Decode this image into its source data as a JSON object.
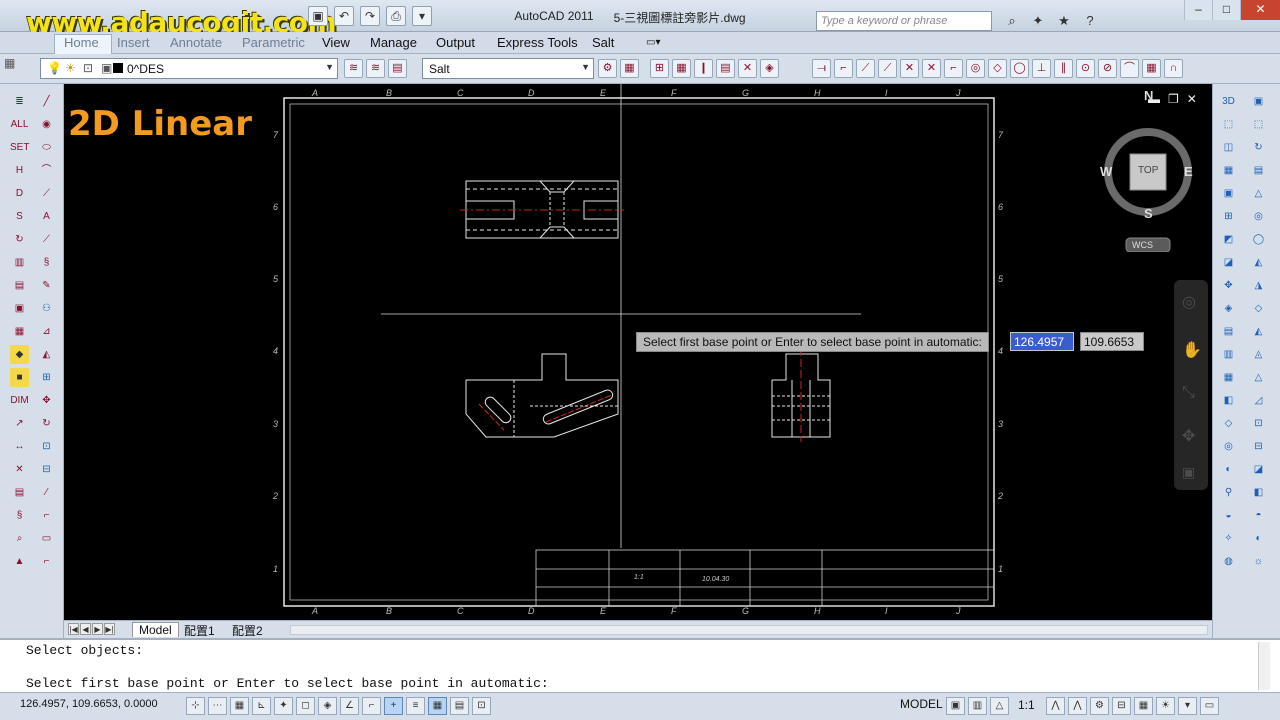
{
  "titlebar": {
    "watermark": "www.adaucogit.com",
    "app_name": "AutoCAD 2011",
    "file_name": "5-三視圖標註旁影片.dwg",
    "search_placeholder": "Type a keyword or phrase"
  },
  "menubar": {
    "items": [
      "Home",
      "Insert",
      "Annotate",
      "Parametric",
      "View",
      "Manage",
      "Output",
      "Express Tools",
      "Salt"
    ]
  },
  "toolbar": {
    "layer_value": "0^DES",
    "style_value": "Salt"
  },
  "canvas": {
    "overlay_title": "2D Linear",
    "border_letters": [
      "A",
      "B",
      "C",
      "D",
      "E",
      "F",
      "G",
      "H",
      "I",
      "J"
    ],
    "border_numbers": [
      "7",
      "6",
      "5",
      "4",
      "3",
      "2",
      "1"
    ],
    "viewcube": {
      "north": "N",
      "south": "S",
      "east": "E",
      "west": "W",
      "face": "TOP",
      "ucs": "WCS"
    },
    "titleblock_date": "10.04.30",
    "titleblock_scale": "1:1"
  },
  "prompt": {
    "text": "Select first base point or Enter to select base point in automatic:",
    "x_value": "126.4957",
    "y_value": "109.6653"
  },
  "layout_tabs": [
    "Model",
    "配置1",
    "配置2"
  ],
  "command": {
    "history": "Select objects:",
    "current": "Select first base point or Enter to select base point in automatic:"
  },
  "status": {
    "coordinates": "126.4957, 109.6653, 0.0000",
    "model_label": "MODEL",
    "scale_label": "1:1"
  },
  "colors": {
    "overlay_title": "#f39a1f",
    "watermark": "#f4e21a",
    "centerline": "#d22020"
  }
}
